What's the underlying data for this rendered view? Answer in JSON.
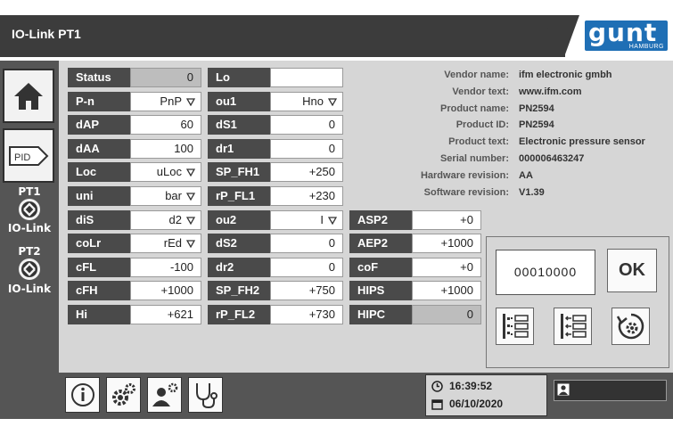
{
  "window": {
    "title": "IO-Link PT1"
  },
  "logo": {
    "brand": "gunt",
    "sub": "HAMBURG",
    "color": "#1f6fb5"
  },
  "sidebar": {
    "items": [
      {
        "name": "home",
        "icon": "home-icon"
      },
      {
        "name": "pid",
        "label": "PID"
      },
      {
        "name": "pt1",
        "label_top": "PT1",
        "label_bottom": "IO-Link",
        "icon": "io-link-icon"
      },
      {
        "name": "pt2",
        "label_top": "PT2",
        "label_bottom": "IO-Link",
        "icon": "io-link-icon"
      }
    ]
  },
  "params": {
    "col1": [
      {
        "label": "Status",
        "value": "0",
        "readonly": true
      },
      {
        "label": "P-n",
        "value": "PnP",
        "dropdown": true
      },
      {
        "label": "dAP",
        "value": "60"
      },
      {
        "label": "dAA",
        "value": "100"
      },
      {
        "label": "Loc",
        "value": "uLoc",
        "dropdown": true
      },
      {
        "label": "uni",
        "value": "bar",
        "dropdown": true
      },
      {
        "label": "diS",
        "value": "d2",
        "dropdown": true
      },
      {
        "label": "coLr",
        "value": "rEd",
        "dropdown": true
      },
      {
        "label": "cFL",
        "value": "-100"
      },
      {
        "label": "cFH",
        "value": "+1000"
      },
      {
        "label": "Hi",
        "value": "+621"
      }
    ],
    "col2": [
      {
        "label": "Lo",
        "value": ""
      },
      {
        "label": "ou1",
        "value": "Hno",
        "dropdown": true
      },
      {
        "label": "dS1",
        "value": "0"
      },
      {
        "label": "dr1",
        "value": "0"
      },
      {
        "label": "SP_FH1",
        "value": "+250"
      },
      {
        "label": "rP_FL1",
        "value": "+230"
      },
      {
        "label": "ou2",
        "value": "I",
        "dropdown": true
      },
      {
        "label": "dS2",
        "value": "0"
      },
      {
        "label": "dr2",
        "value": "0"
      },
      {
        "label": "SP_FH2",
        "value": "+750"
      },
      {
        "label": "rP_FL2",
        "value": "+730"
      }
    ],
    "col3": [
      {
        "label": "ASP2",
        "value": "+0"
      },
      {
        "label": "AEP2",
        "value": "+1000"
      },
      {
        "label": "coF",
        "value": "+0"
      },
      {
        "label": "HIPS",
        "value": "+1000"
      },
      {
        "label": "HIPC",
        "value": "0",
        "readonly": true
      }
    ]
  },
  "device_info": [
    {
      "key": "Vendor name:",
      "value": "ifm electronic gmbh"
    },
    {
      "key": "Vendor text:",
      "value": "www.ifm.com"
    },
    {
      "key": "Product name:",
      "value": "PN2594"
    },
    {
      "key": "Product ID:",
      "value": "PN2594"
    },
    {
      "key": "Product text:",
      "value": "Electronic pressure sensor"
    },
    {
      "key": "Serial number:",
      "value": "000006463247"
    },
    {
      "key": "Hardware revision:",
      "value": "AA"
    },
    {
      "key": "Software revision:",
      "value": "V1.39"
    }
  ],
  "panel": {
    "code": "00010000",
    "ok_label": "OK",
    "buttons": [
      "read-params-icon",
      "write-params-icon",
      "reset-settings-icon"
    ]
  },
  "bottombar": {
    "buttons": [
      "info-icon",
      "settings-icon",
      "user-settings-icon",
      "stethoscope-icon"
    ],
    "time": "16:39:52",
    "date": "06/10/2020"
  }
}
